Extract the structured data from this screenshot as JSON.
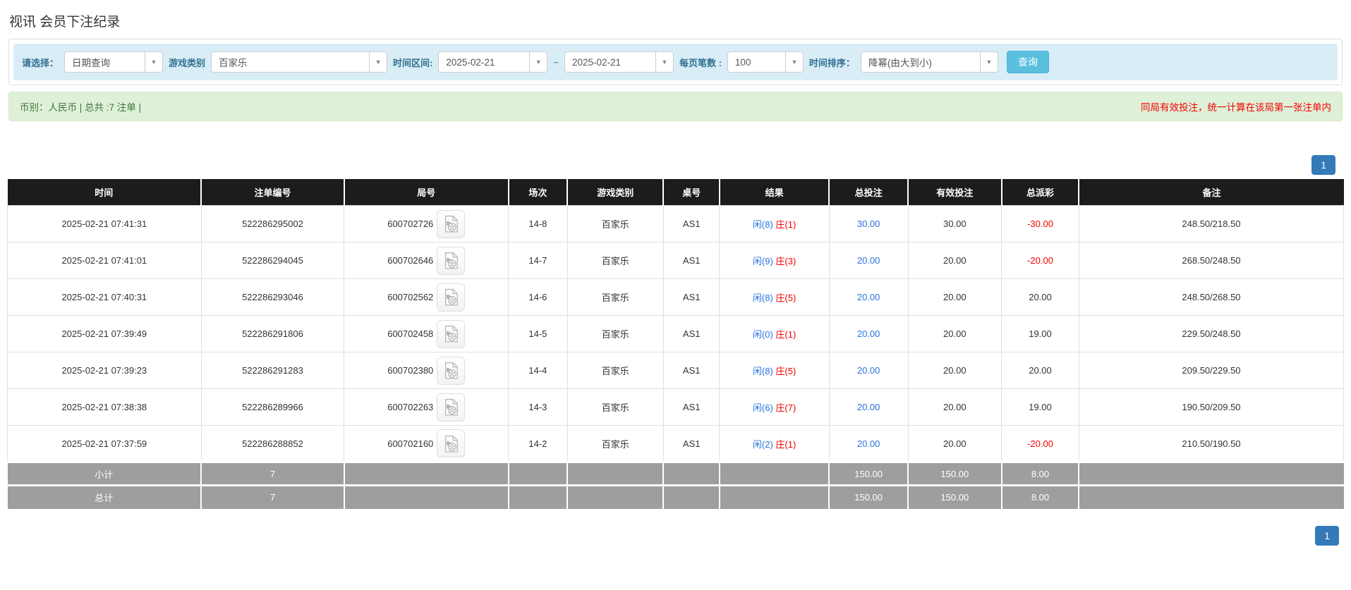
{
  "page": {
    "title": "视讯 会员下注纪录"
  },
  "filters": {
    "select_label": "请选择：",
    "select_value": "日期查询",
    "game_label": "游戏类别",
    "game_value": "百家乐",
    "range_label": "时间区间:",
    "date_from": "2025-02-21",
    "range_separator": "~",
    "date_to": "2025-02-21",
    "per_page_label": "每页笔数 :",
    "per_page_value": "100",
    "sort_label": "时间排序：",
    "sort_value": "降幂(由大到小)",
    "search_button": "查询"
  },
  "summary": {
    "left_text": "币别：人民币 | 总共 :7 注单 |",
    "right_note": "同局有效投注，统一计算在该局第一张注单内"
  },
  "pagination": {
    "page": "1"
  },
  "table": {
    "headers": [
      "时间",
      "注单编号",
      "局号",
      "场次",
      "游戏类别",
      "桌号",
      "结果",
      "总投注",
      "有效投注",
      "总派彩",
      "备注"
    ],
    "rows": [
      {
        "time": "2025-02-21 07:41:31",
        "bet_id": "522286295002",
        "round_id": "600702726",
        "session": "14-8",
        "game": "百家乐",
        "table_no": "AS1",
        "result_player": "闲(8)",
        "result_banker": "庄(1)",
        "total_bet": "30.00",
        "valid_bet": "30.00",
        "payout": "-30.00",
        "note": "248.50/218.50"
      },
      {
        "time": "2025-02-21 07:41:01",
        "bet_id": "522286294045",
        "round_id": "600702646",
        "session": "14-7",
        "game": "百家乐",
        "table_no": "AS1",
        "result_player": "闲(9)",
        "result_banker": "庄(3)",
        "total_bet": "20.00",
        "valid_bet": "20.00",
        "payout": "-20.00",
        "note": "268.50/248.50"
      },
      {
        "time": "2025-02-21 07:40:31",
        "bet_id": "522286293046",
        "round_id": "600702562",
        "session": "14-6",
        "game": "百家乐",
        "table_no": "AS1",
        "result_player": "闲(8)",
        "result_banker": "庄(5)",
        "total_bet": "20.00",
        "valid_bet": "20.00",
        "payout": "20.00",
        "note": "248.50/268.50"
      },
      {
        "time": "2025-02-21 07:39:49",
        "bet_id": "522286291806",
        "round_id": "600702458",
        "session": "14-5",
        "game": "百家乐",
        "table_no": "AS1",
        "result_player": "闲(0)",
        "result_banker": "庄(1)",
        "total_bet": "20.00",
        "valid_bet": "20.00",
        "payout": "19.00",
        "note": "229.50/248.50"
      },
      {
        "time": "2025-02-21 07:39:23",
        "bet_id": "522286291283",
        "round_id": "600702380",
        "session": "14-4",
        "game": "百家乐",
        "table_no": "AS1",
        "result_player": "闲(8)",
        "result_banker": "庄(5)",
        "total_bet": "20.00",
        "valid_bet": "20.00",
        "payout": "20.00",
        "note": "209.50/229.50"
      },
      {
        "time": "2025-02-21 07:38:38",
        "bet_id": "522286289966",
        "round_id": "600702263",
        "session": "14-3",
        "game": "百家乐",
        "table_no": "AS1",
        "result_player": "闲(6)",
        "result_banker": "庄(7)",
        "total_bet": "20.00",
        "valid_bet": "20.00",
        "payout": "19.00",
        "note": "190.50/209.50"
      },
      {
        "time": "2025-02-21 07:37:59",
        "bet_id": "522286288852",
        "round_id": "600702160",
        "session": "14-2",
        "game": "百家乐",
        "table_no": "AS1",
        "result_player": "闲(2)",
        "result_banker": "庄(1)",
        "total_bet": "20.00",
        "valid_bet": "20.00",
        "payout": "-20.00",
        "note": "210.50/190.50"
      }
    ],
    "subtotal_row": [
      "小计",
      "7",
      "",
      "",
      "",
      "",
      "",
      "150.00",
      "150.00",
      "8.00",
      ""
    ],
    "total_row": [
      "总计",
      "7",
      "",
      "",
      "",
      "",
      "",
      "150.00",
      "150.00",
      "8.00",
      ""
    ]
  },
  "icons": {
    "video_record": "video-file-icon",
    "dropdown": "chevron-down-icon"
  },
  "colors": {
    "link_blue": "#2a72dd",
    "negative_red": "#f40000",
    "header_bg": "#1c1c1c",
    "subtotal_bg": "#9e9e9e",
    "button_teal": "#5bc0de",
    "pagination_blue": "#337ab7",
    "filter_bg": "#d9edf7",
    "filter_label": "#31708f",
    "alert_bg": "#dff0d8",
    "alert_text": "#3c763d"
  }
}
